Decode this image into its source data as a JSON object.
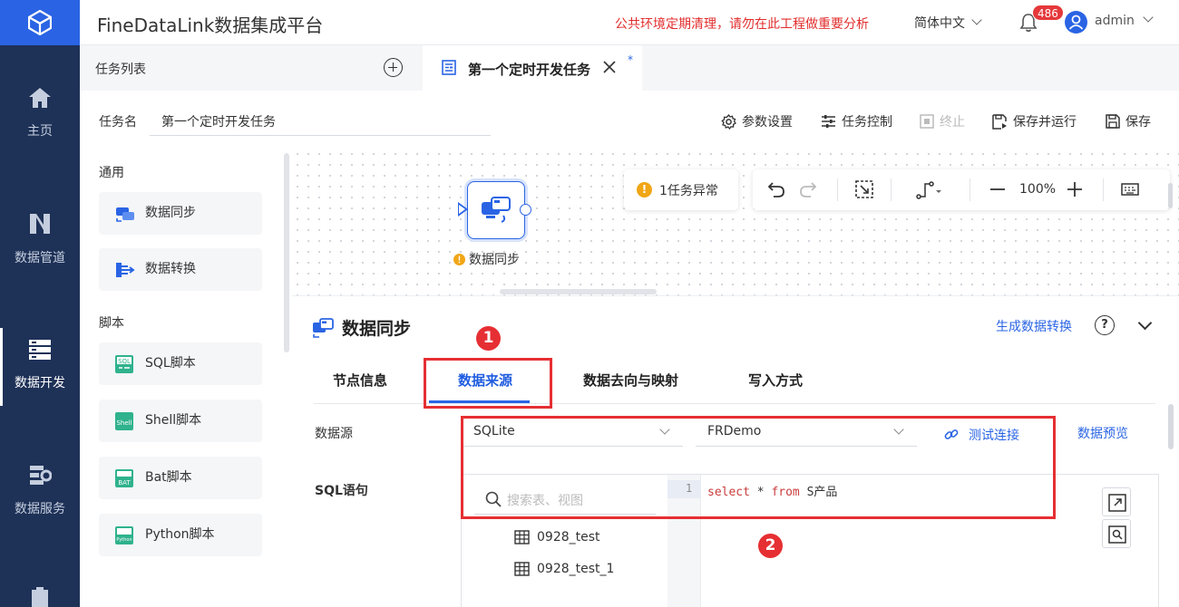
{
  "sidebar": {
    "items": [
      {
        "label": "主页",
        "icon": "home-icon"
      },
      {
        "label": "数据管道",
        "icon": "pipeline-icon"
      },
      {
        "label": "数据开发",
        "icon": "data-dev-icon",
        "active": true
      },
      {
        "label": "数据服务",
        "icon": "data-service-icon"
      }
    ]
  },
  "header": {
    "title": "FineDataLink数据集成平台",
    "warning": "公共环境定期清理，请勿在此工程做重要分析",
    "language": "简体中文",
    "notification_count": "486",
    "user": "admin"
  },
  "tabs": {
    "list_label": "任务列表",
    "active_tab": "第一个定时开发任务",
    "modified_mark": "*"
  },
  "task": {
    "name_label": "任务名",
    "name_value": "第一个定时开发任务",
    "tools": {
      "params": "参数设置",
      "control": "任务控制",
      "stop": "终止",
      "save_run": "保存并运行",
      "save": "保存"
    }
  },
  "palette": {
    "general_title": "通用",
    "script_title": "脚本",
    "general": [
      "数据同步",
      "数据转换"
    ],
    "scripts": [
      "SQL脚本",
      "Shell脚本",
      "Bat脚本",
      "Python脚本"
    ]
  },
  "canvas": {
    "node_label": "数据同步",
    "error_text": "1任务异常",
    "error_mark": "!",
    "zoom": "100%"
  },
  "props": {
    "title": "数据同步",
    "generate_link": "生成数据转换",
    "help": "?",
    "tabs": [
      "节点信息",
      "数据来源",
      "数据去向与映射",
      "写入方式"
    ],
    "active_tab": "数据来源",
    "datasource_label": "数据源",
    "db_type": "SQLite",
    "connection": "FRDemo",
    "test_connection": "测试连接",
    "data_preview": "数据预览",
    "sql_label": "SQL语句",
    "search_placeholder": "搜索表、视图",
    "tables": [
      "0928_test",
      "0928_test_1"
    ],
    "line_number": "1",
    "sql_code": {
      "kw1": "select",
      "star": " * ",
      "kw2": "from",
      "rest": " S产品"
    }
  },
  "annotations": [
    "1",
    "2"
  ],
  "colors": {
    "accent": "#2a64e4",
    "sidebar": "#1e3157",
    "annotation": "#e62f33",
    "warning": "#e22d2d"
  }
}
